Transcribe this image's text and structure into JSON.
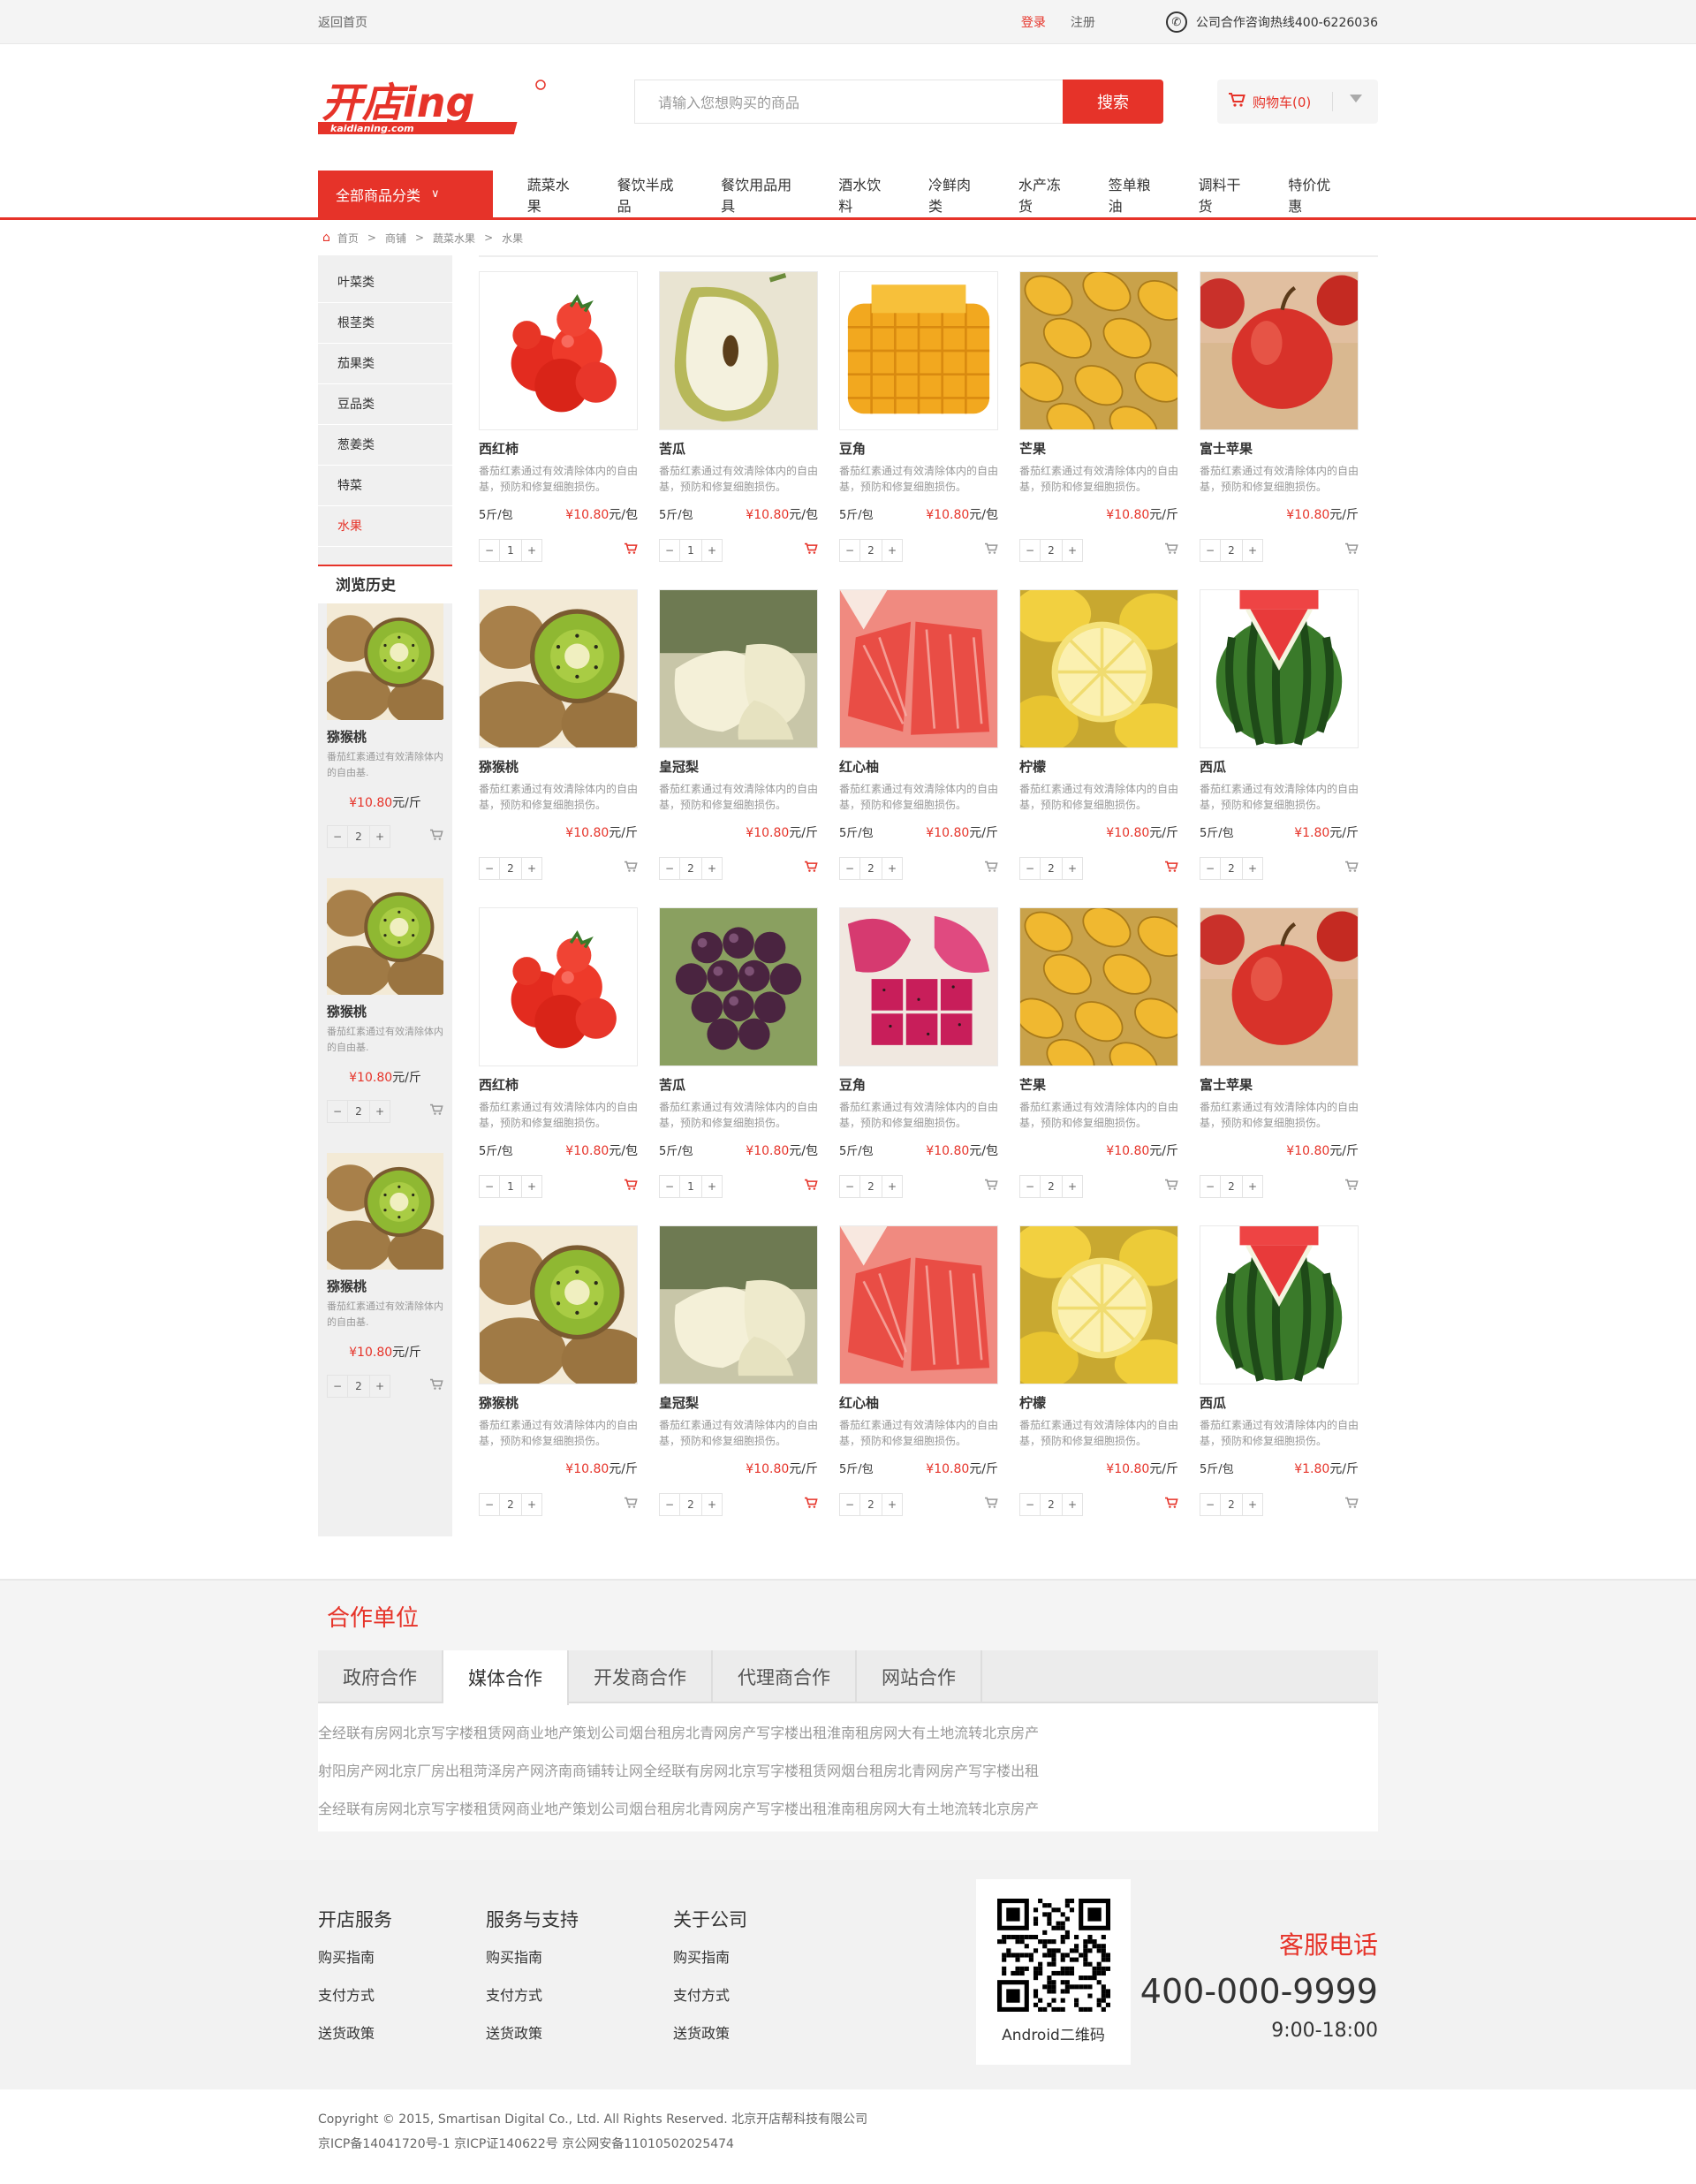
{
  "topbar": {
    "back": "返回首页",
    "login": "登录",
    "register": "注册",
    "hotline": "公司合作咨询热线400-6226036"
  },
  "header": {
    "logo_main": "开店ing",
    "logo_sub": "kaidianing.com",
    "search_placeholder": "请输入您想购买的商品",
    "search_button": "搜索",
    "cart_label": "购物车(0)"
  },
  "nav": {
    "all_categories": "全部商品分类",
    "items": [
      "蔬菜水果",
      "餐饮半成品",
      "餐饮用品用具",
      "酒水饮料",
      "冷鲜肉类",
      "水产冻货",
      "签单粮油",
      "调料干货",
      "特价优惠"
    ]
  },
  "breadcrumb": [
    "首页",
    "商铺",
    "蔬菜水果",
    "水果"
  ],
  "sidebar": {
    "categories": [
      "叶菜类",
      "根茎类",
      "茄果类",
      "豆品类",
      "葱姜类",
      "特菜",
      "水果"
    ],
    "history_title": "浏览历史",
    "history": [
      {
        "name": "猕猴桃",
        "desc": "番茄红素通过有效清除体内的自由基.",
        "price": "¥10.80",
        "unit": "元/斤",
        "qty": "2"
      },
      {
        "name": "猕猴桃",
        "desc": "番茄红素通过有效清除体内的自由基.",
        "price": "¥10.80",
        "unit": "元/斤",
        "qty": "2"
      },
      {
        "name": "猕猴桃",
        "desc": "番茄红素通过有效清除体内的自由基.",
        "price": "¥10.80",
        "unit": "元/斤",
        "qty": "2"
      }
    ]
  },
  "product_desc": "番茄红素通过有效清除体内的自由基，预防和修复细胞损伤。",
  "products": [
    {
      "name": "西红柿",
      "spec": "5斤/包",
      "price": "¥10.80",
      "unit": "元/包",
      "qty": "1",
      "img": "tomato",
      "cart_red": true
    },
    {
      "name": "苦瓜",
      "spec": "5斤/包",
      "price": "¥10.80",
      "unit": "元/包",
      "qty": "1",
      "img": "pear",
      "cart_red": true
    },
    {
      "name": "豆角",
      "spec": "5斤/包",
      "price": "¥10.80",
      "unit": "元/包",
      "qty": "2",
      "img": "mango",
      "cart_red": false
    },
    {
      "name": "芒果",
      "spec": "",
      "price": "¥10.80",
      "unit": "元/斤",
      "qty": "2",
      "img": "mangoes",
      "cart_red": false
    },
    {
      "name": "富士苹果",
      "spec": "",
      "price": "¥10.80",
      "unit": "元/斤",
      "qty": "2",
      "img": "apple",
      "cart_red": false
    },
    {
      "name": "猕猴桃",
      "spec": "",
      "price": "¥10.80",
      "unit": "元/斤",
      "qty": "2",
      "img": "kiwi",
      "cart_red": false
    },
    {
      "name": "皇冠梨",
      "spec": "",
      "price": "¥10.80",
      "unit": "元/斤",
      "qty": "2",
      "img": "crownpear",
      "cart_red": true
    },
    {
      "name": "红心柚",
      "spec": "5斤/包",
      "price": "¥10.80",
      "unit": "元/斤",
      "qty": "2",
      "img": "pomelo",
      "cart_red": false
    },
    {
      "name": "柠檬",
      "spec": "",
      "price": "¥10.80",
      "unit": "元/斤",
      "qty": "2",
      "img": "lemon",
      "cart_red": true
    },
    {
      "name": "西瓜",
      "spec": "5斤/包",
      "price": "¥1.80",
      "unit": "元/斤",
      "qty": "2",
      "img": "watermelon",
      "cart_red": false
    },
    {
      "name": "西红柿",
      "spec": "5斤/包",
      "price": "¥10.80",
      "unit": "元/包",
      "qty": "1",
      "img": "tomato",
      "cart_red": true
    },
    {
      "name": "苦瓜",
      "spec": "5斤/包",
      "price": "¥10.80",
      "unit": "元/包",
      "qty": "1",
      "img": "grape",
      "cart_red": true
    },
    {
      "name": "豆角",
      "spec": "5斤/包",
      "price": "¥10.80",
      "unit": "元/包",
      "qty": "2",
      "img": "dragonfruit",
      "cart_red": false
    },
    {
      "name": "芒果",
      "spec": "",
      "price": "¥10.80",
      "unit": "元/斤",
      "qty": "2",
      "img": "mangoes",
      "cart_red": false
    },
    {
      "name": "富士苹果",
      "spec": "",
      "price": "¥10.80",
      "unit": "元/斤",
      "qty": "2",
      "img": "apple",
      "cart_red": false
    },
    {
      "name": "猕猴桃",
      "spec": "",
      "price": "¥10.80",
      "unit": "元/斤",
      "qty": "2",
      "img": "kiwi",
      "cart_red": false
    },
    {
      "name": "皇冠梨",
      "spec": "",
      "price": "¥10.80",
      "unit": "元/斤",
      "qty": "2",
      "img": "crownpear",
      "cart_red": true
    },
    {
      "name": "红心柚",
      "spec": "5斤/包",
      "price": "¥10.80",
      "unit": "元/斤",
      "qty": "2",
      "img": "pomelo",
      "cart_red": false
    },
    {
      "name": "柠檬",
      "spec": "",
      "price": "¥10.80",
      "unit": "元/斤",
      "qty": "2",
      "img": "lemon",
      "cart_red": true
    },
    {
      "name": "西瓜",
      "spec": "5斤/包",
      "price": "¥1.80",
      "unit": "元/斤",
      "qty": "2",
      "img": "watermelon",
      "cart_red": false
    }
  ],
  "partners": {
    "title": "合作单位",
    "tabs": [
      "政府合作",
      "媒体合作",
      "开发商合作",
      "代理商合作",
      "网站合作"
    ],
    "active_tab": 1,
    "rows": [
      [
        "全经联",
        "有房网",
        "北京写字楼租赁网",
        "商业地产策划公司",
        "烟台租房",
        "北青网房产",
        "写字楼出租",
        "淮南租房网",
        "大有土地流转",
        "北京房产"
      ],
      [
        "射阳房产网",
        "北京厂房出租",
        "菏泽房产网",
        "济南商铺转让网",
        "全经联",
        "有房网",
        "北京写字楼租赁网",
        "烟台租房",
        "北青网房产",
        "写字楼出租"
      ],
      [
        "全经联",
        "有房网",
        "北京写字楼租赁网",
        "商业地产策划公司",
        "烟台租房",
        "北青网房产",
        "写字楼出租",
        "淮南租房网",
        "大有土地流转",
        "北京房产"
      ]
    ]
  },
  "footer": {
    "cols": [
      {
        "title": "开店服务",
        "links": [
          "购买指南",
          "支付方式",
          "送货政策"
        ]
      },
      {
        "title": "服务与支持",
        "links": [
          "购买指南",
          "支付方式",
          "送货政策"
        ]
      },
      {
        "title": "关于公司",
        "links": [
          "购买指南",
          "支付方式",
          "送货政策"
        ]
      }
    ],
    "qr_caption": "Android二维码",
    "service_title": "客服电话",
    "service_phone": "400-000-9999",
    "service_hours": "9:00-18:00",
    "copyright": "Copyright © 2015, Smartisan Digital Co., Ltd. All Rights Reserved. 北京开店帮科技有限公司",
    "icp": "京ICP备14041720号-1 京ICP证140622号 京公网安备11010502025474"
  },
  "colors": {
    "accent": "#e63329"
  }
}
